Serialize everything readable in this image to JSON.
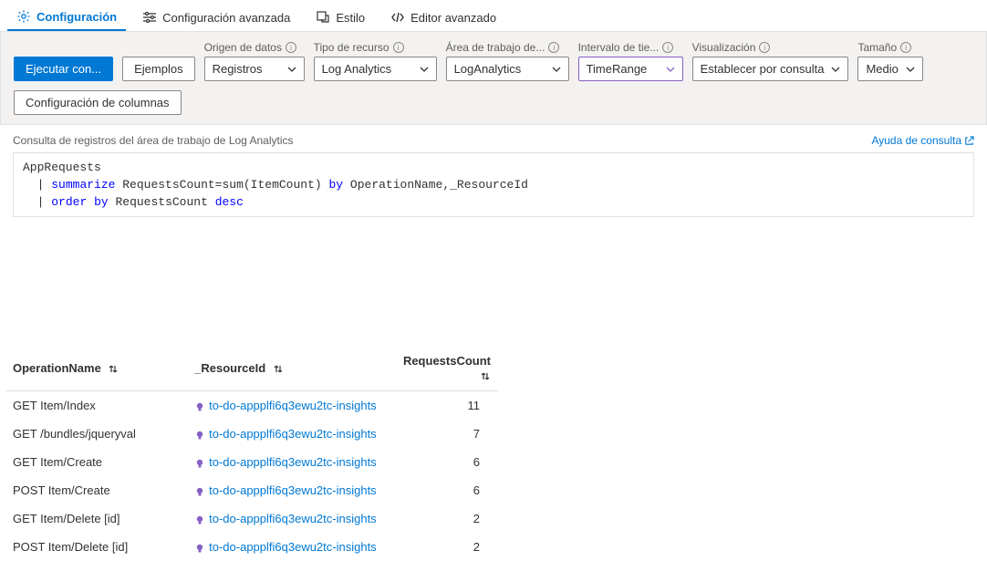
{
  "tabs": {
    "config": "Configuración",
    "advanced_config": "Configuración avanzada",
    "style": "Estilo",
    "advanced_editor": "Editor avanzado"
  },
  "toolbar": {
    "run_query": "Ejecutar con...",
    "examples": "Ejemplos",
    "data_source_label": "Origen de datos",
    "data_source_value": "Registros",
    "resource_type_label": "Tipo de recurso",
    "resource_type_value": "Log Analytics",
    "workspace_label": "Área de trabajo de...",
    "workspace_value": "LogAnalytics",
    "timerange_label": "Intervalo de tie...",
    "timerange_value": "TimeRange",
    "visualization_label": "Visualización",
    "visualization_value": "Establecer por consulta",
    "size_label": "Tamaño",
    "size_value": "Medio",
    "column_config": "Configuración de columnas"
  },
  "subheader": {
    "title": "Consulta de registros del área de trabajo de Log Analytics",
    "help": "Ayuda de consulta"
  },
  "query": {
    "l1": "AppRequests",
    "l2_pipe": "|",
    "l2_kw": "summarize",
    "l2_rest": " RequestsCount=sum(ItemCount) ",
    "l2_by": "by",
    "l2_cols": " OperationName,_ResourceId",
    "l3_pipe": "|",
    "l3_order": "order",
    "l3_by": "by",
    "l3_rest": " RequestsCount ",
    "l3_desc": "desc"
  },
  "table": {
    "headers": {
      "operation": "OperationName",
      "resource": "_ResourceId",
      "count": "RequestsCount"
    },
    "resource_link_text": "to-do-appplfi6q3ewu2tc-insights",
    "rows": [
      {
        "op": "GET Item/Index",
        "count": "11"
      },
      {
        "op": "GET /bundles/jqueryval",
        "count": "7"
      },
      {
        "op": "GET Item/Create",
        "count": "6"
      },
      {
        "op": "POST Item/Create",
        "count": "6"
      },
      {
        "op": "GET Item/Delete [id]",
        "count": "2"
      },
      {
        "op": "POST Item/Delete [id]",
        "count": "2"
      }
    ]
  }
}
